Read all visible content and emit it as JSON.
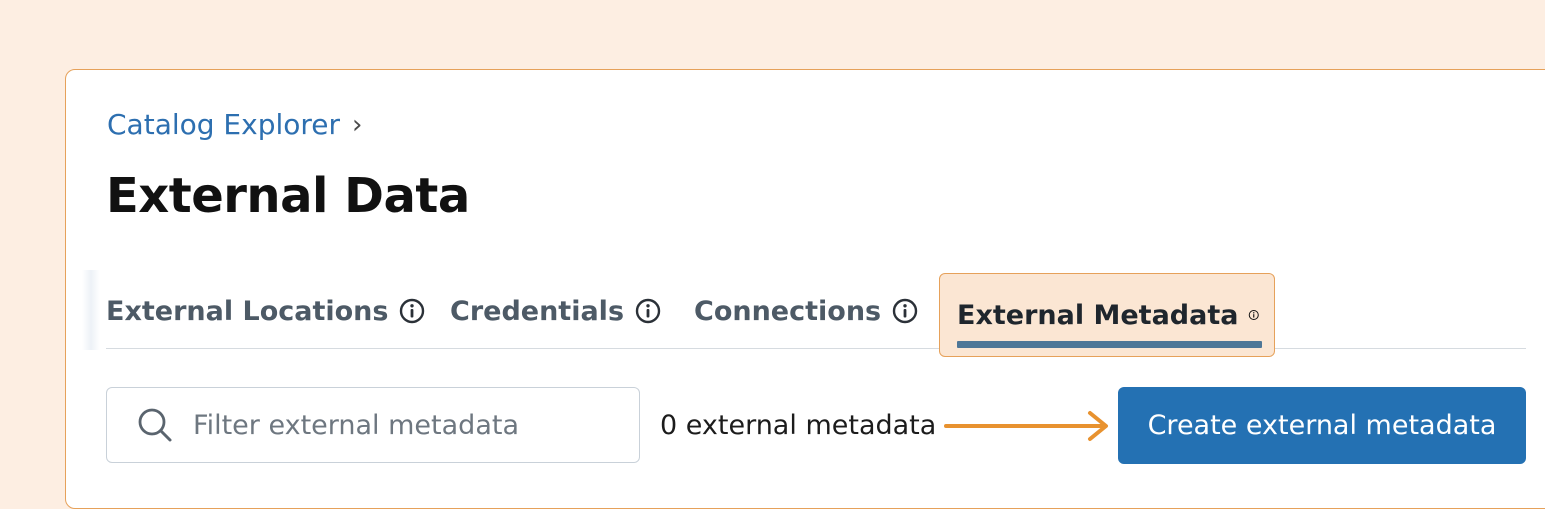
{
  "breadcrumb": {
    "root_label": "Catalog Explorer",
    "separator": "›"
  },
  "page": {
    "title": "External Data"
  },
  "tabs": [
    {
      "label": "External Locations",
      "icon": "info-icon",
      "active": false
    },
    {
      "label": "Credentials",
      "icon": "info-icon",
      "active": false
    },
    {
      "label": "Connections",
      "icon": "info-icon",
      "active": false
    },
    {
      "label": "External Metadata",
      "icon": "info-icon",
      "active": true
    }
  ],
  "toolbar": {
    "search_placeholder": "Filter external metadata",
    "search_value": "",
    "count_text": "0 external metadata",
    "create_label": "Create external metadata"
  },
  "colors": {
    "page_background": "#fdeee2",
    "highlight_border": "#e6a15a",
    "active_tab_fill": "#fbe6d3",
    "active_tab_underline": "#4e7797",
    "link_blue": "#2d6fb0",
    "primary_button": "#2471b3",
    "annotation_arrow": "#e8922f"
  }
}
